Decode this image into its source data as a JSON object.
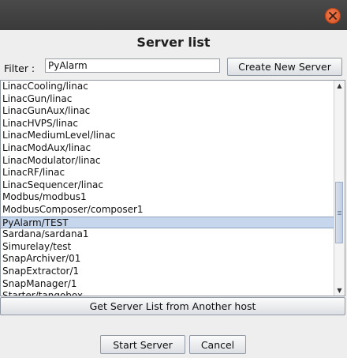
{
  "dialog": {
    "title": "Server list",
    "filter_label": "Filter :",
    "filter_value": "PyAlarm",
    "create_button": "Create New Server",
    "get_list_button": "Get Server List from Another host",
    "start_button": "Start Server",
    "cancel_button": "Cancel"
  },
  "list": {
    "items": [
      "LinacCooling/linac",
      "LinacGun/linac",
      "LinacGunAux/linac",
      "LinacHVPS/linac",
      "LinacMediumLevel/linac",
      "LinacModAux/linac",
      "LinacModulator/linac",
      "LinacRF/linac",
      "LinacSequencer/linac",
      "Modbus/modbus1",
      "ModbusComposer/composer1",
      "PyAlarm/TEST",
      "Sardana/sardana1",
      "Simurelay/test",
      "SnapArchiver/01",
      "SnapExtractor/1",
      "SnapManager/1",
      "Starter/tangobox"
    ],
    "selected": "PyAlarm/TEST"
  }
}
